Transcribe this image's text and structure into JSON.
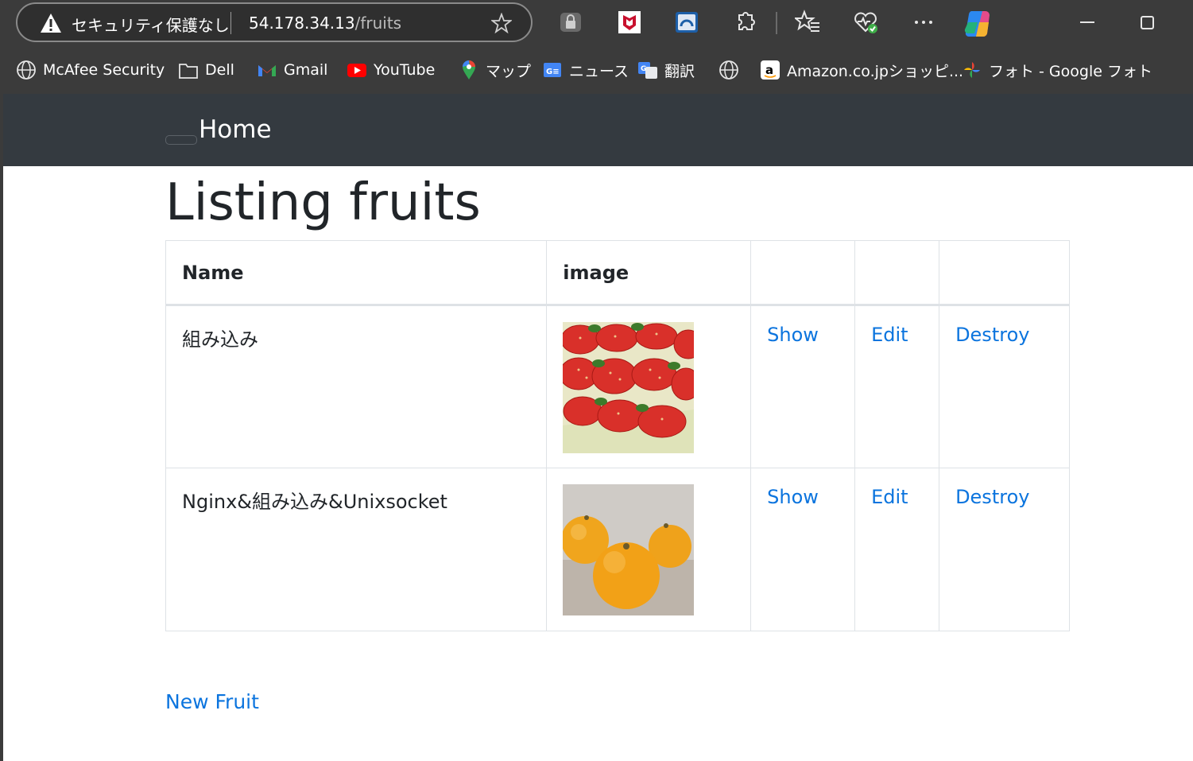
{
  "browser": {
    "security_label": "セキュリティ保護なし",
    "url_host": "54.178.34.13",
    "url_path": "/fruits",
    "bookmarks": [
      {
        "label": "McAfee Security",
        "icon": "globe-icon"
      },
      {
        "label": "Dell",
        "icon": "folder-icon"
      },
      {
        "label": "Gmail",
        "icon": "gmail-icon"
      },
      {
        "label": "YouTube",
        "icon": "youtube-icon"
      },
      {
        "label": "マップ",
        "icon": "maps-icon"
      },
      {
        "label": "ニュース",
        "icon": "news-icon"
      },
      {
        "label": "翻訳",
        "icon": "translate-icon"
      },
      {
        "label": "",
        "icon": "globe-icon"
      },
      {
        "label": "Amazon.co.jpショッピ...",
        "icon": "amazon-icon"
      },
      {
        "label": "フォト - Google フォト",
        "icon": "photos-icon"
      }
    ]
  },
  "navbar": {
    "home_label": "Home"
  },
  "page": {
    "title": "Listing fruits",
    "table": {
      "headers": [
        "Name",
        "image",
        "",
        "",
        ""
      ],
      "rows": [
        {
          "name": "組み込み",
          "image": "strawberries-photo",
          "show": "Show",
          "edit": "Edit",
          "destroy": "Destroy"
        },
        {
          "name": "Nginx&組み込み&Unixsocket",
          "image": "oranges-photo",
          "show": "Show",
          "edit": "Edit",
          "destroy": "Destroy"
        }
      ]
    },
    "new_link": "New Fruit"
  },
  "colors": {
    "navbar_bg": "#343a40",
    "link": "#0b74de",
    "browser_chrome": "#3b3b3b"
  }
}
